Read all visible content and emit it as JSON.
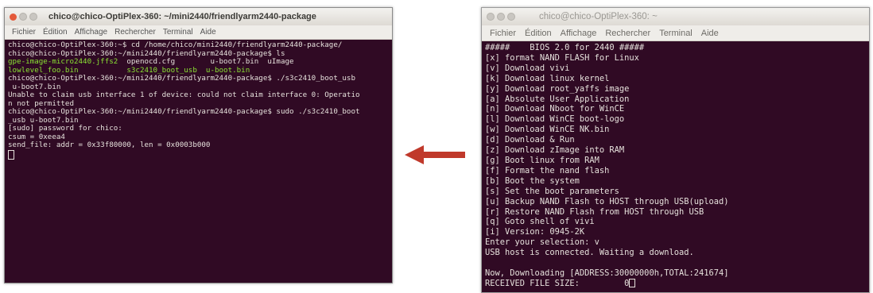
{
  "left_window": {
    "title": "chico@chico-OptiPlex-360: ~/mini2440/friendlyarm2440-package",
    "menu": [
      "Fichier",
      "Édition",
      "Affichage",
      "Rechercher",
      "Terminal",
      "Aide"
    ],
    "lines": [
      "chico@chico-OptiPlex-360:~$ cd /home/chico/mini2440/friendlyarm2440-package/",
      "chico@chico-OptiPlex-360:~/mini2440/friendlyarm2440-package$ ls",
      {
        "parts": [
          {
            "t": "gpe-image-micro2440.jffs2",
            "g": true
          },
          {
            "t": "  openocd.cfg        u-boot7.bin  uImage",
            "g": false
          }
        ]
      },
      {
        "parts": [
          {
            "t": "lowlevel_foo.bin           s3c2410_boot_usb  u-boot.bin",
            "g": true
          }
        ]
      },
      "chico@chico-OptiPlex-360:~/mini2440/friendlyarm2440-package$ ./s3c2410_boot_usb",
      " u-boot7.bin",
      "Unable to claim usb interface 1 of device: could not claim interface 0: Operatio",
      "n not permitted",
      "chico@chico-OptiPlex-360:~/mini2440/friendlyarm2440-package$ sudo ./s3c2410_boot",
      "_usb u-boot7.bin",
      "[sudo] password for chico:",
      "csum = 0xeea4",
      "send_file: addr = 0x33f80000, len = 0x0003b000"
    ]
  },
  "right_window": {
    "title": "chico@chico-OptiPlex-360: ~",
    "menu": [
      "Fichier",
      "Édition",
      "Affichage",
      "Rechercher",
      "Terminal",
      "Aide"
    ],
    "lines": [
      "#####    BIOS 2.0 for 2440 #####",
      "[x] format NAND FLASH for Linux",
      "[v] Download vivi",
      "[k] Download linux kernel",
      "[y] Download root_yaffs image",
      "[a] Absolute User Application",
      "[n] Download Nboot for WinCE",
      "[l] Download WinCE boot-logo",
      "[w] Download WinCE NK.bin",
      "[d] Download & Run",
      "[z] Download zImage into RAM",
      "[g] Boot linux from RAM",
      "[f] Format the nand flash",
      "[b] Boot the system",
      "[s] Set the boot parameters",
      "[u] Backup NAND Flash to HOST through USB(upload)",
      "[r] Restore NAND Flash from HOST through USB",
      "[q] Goto shell of vivi",
      "[i] Version: 0945-2K",
      "Enter your selection: v",
      "USB host is connected. Waiting a download.",
      "",
      "Now, Downloading [ADDRESS:30000000h,TOTAL:241674]",
      "RECEIVED FILE SIZE:         0"
    ]
  },
  "colors": {
    "terminal_bg": "#300a24",
    "terminal_fg": "#e6e1dc",
    "highlight_green": "#8ae234",
    "arrow": "#c0392b"
  },
  "arrow_icon": "left-arrow-icon"
}
